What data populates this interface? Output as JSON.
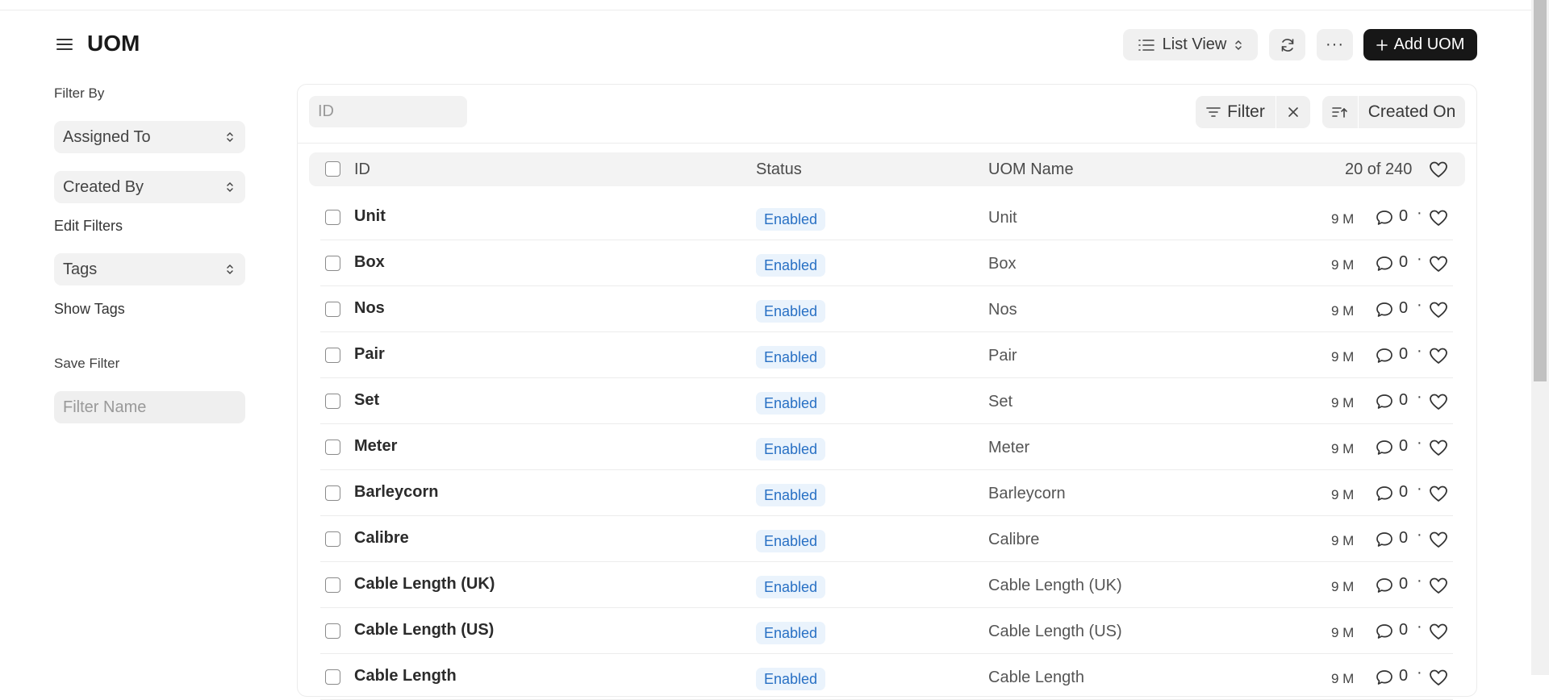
{
  "page": {
    "title": "UOM"
  },
  "toolbar": {
    "list_view_label": "List View",
    "more_label": "···",
    "add_label": "Add UOM"
  },
  "sidebar": {
    "filter_by_label": "Filter By",
    "assigned_to_label": "Assigned To",
    "created_by_label": "Created By",
    "edit_filters_label": "Edit Filters",
    "tags_label": "Tags",
    "show_tags_label": "Show Tags",
    "save_filter_label": "Save Filter",
    "filter_name_placeholder": "Filter Name"
  },
  "list": {
    "search_placeholder": "ID",
    "filter_label": "Filter",
    "sort_field_label": "Created On",
    "columns": {
      "id": "ID",
      "status": "Status",
      "uom_name": "UOM Name"
    },
    "count_label": "20 of 240",
    "rows": [
      {
        "id": "Unit",
        "status": "Enabled",
        "uom_name": "Unit",
        "modified": "9 M",
        "comments": "0"
      },
      {
        "id": "Box",
        "status": "Enabled",
        "uom_name": "Box",
        "modified": "9 M",
        "comments": "0"
      },
      {
        "id": "Nos",
        "status": "Enabled",
        "uom_name": "Nos",
        "modified": "9 M",
        "comments": "0"
      },
      {
        "id": "Pair",
        "status": "Enabled",
        "uom_name": "Pair",
        "modified": "9 M",
        "comments": "0"
      },
      {
        "id": "Set",
        "status": "Enabled",
        "uom_name": "Set",
        "modified": "9 M",
        "comments": "0"
      },
      {
        "id": "Meter",
        "status": "Enabled",
        "uom_name": "Meter",
        "modified": "9 M",
        "comments": "0"
      },
      {
        "id": "Barleycorn",
        "status": "Enabled",
        "uom_name": "Barleycorn",
        "modified": "9 M",
        "comments": "0"
      },
      {
        "id": "Calibre",
        "status": "Enabled",
        "uom_name": "Calibre",
        "modified": "9 M",
        "comments": "0"
      },
      {
        "id": "Cable Length (UK)",
        "status": "Enabled",
        "uom_name": "Cable Length (UK)",
        "modified": "9 M",
        "comments": "0"
      },
      {
        "id": "Cable Length (US)",
        "status": "Enabled",
        "uom_name": "Cable Length (US)",
        "modified": "9 M",
        "comments": "0"
      },
      {
        "id": "Cable Length",
        "status": "Enabled",
        "uom_name": "Cable Length",
        "modified": "9 M",
        "comments": "0"
      }
    ]
  },
  "colors": {
    "primary_button": "#171717",
    "badge_bg": "#eaf3fc",
    "badge_text": "#2870c4"
  },
  "icons": [
    "hamburger-icon",
    "list-icon",
    "sort-updown-icon",
    "refresh-icon",
    "plus-icon",
    "filter-icon",
    "close-icon",
    "sort-ascending-icon",
    "comment-icon",
    "heart-icon"
  ]
}
